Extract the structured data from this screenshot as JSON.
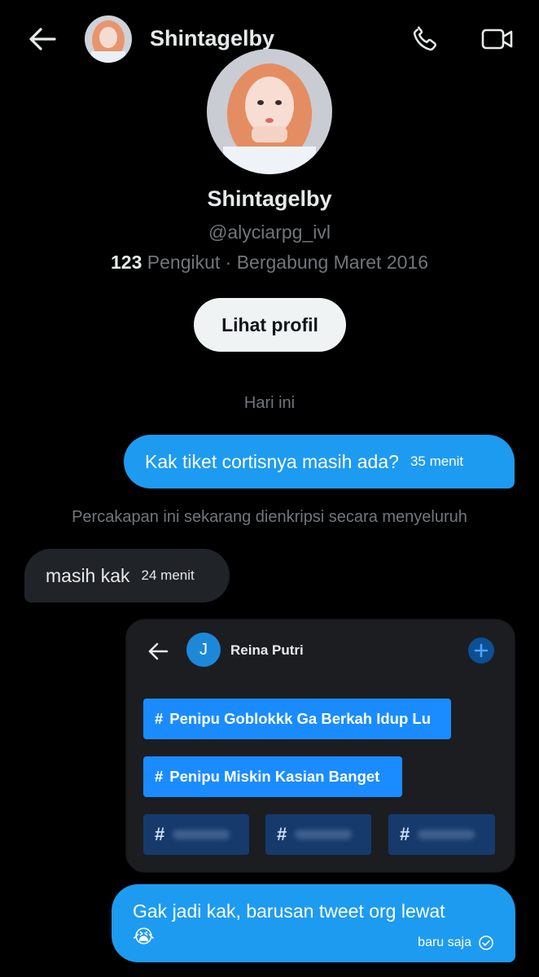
{
  "header": {
    "title": "Shintagelby"
  },
  "profile": {
    "name": "Shintagelby",
    "handle": "@alyciarpg_ivl",
    "followers_count": "123",
    "meta_text": " Pengikut · Bergabung Maret 2016",
    "view_profile_label": "Lihat profil"
  },
  "conversation": {
    "date_label": "Hari ini",
    "encryption_note": "Percakapan ini sekarang dienkripsi secara menyeluruh",
    "messages": [
      {
        "direction": "out",
        "text": "Kak tiket cortisnya masih ada?",
        "time": "35 menit"
      },
      {
        "direction": "in",
        "text": "masih kak",
        "time": "24 menit"
      },
      {
        "direction": "out",
        "text": "Gak jadi kak, barusan tweet org lewat",
        "emoji": "😭",
        "time": "baru saja"
      }
    ]
  },
  "shared_image": {
    "avatar_letter": "J",
    "name": "Reina Putri",
    "tags": [
      {
        "hash": "#",
        "label": "Penipu Goblokkk Ga Berkah Idup Lu"
      },
      {
        "hash": "#",
        "label": "Penipu Miskin Kasian Banget"
      }
    ],
    "blurred_tags": [
      {
        "hash": "#"
      },
      {
        "hash": "#"
      },
      {
        "hash": "#"
      }
    ]
  },
  "colors": {
    "accent": "#1d9bf0",
    "background": "#000000",
    "incoming_bubble": "#202327",
    "muted_text": "#71767b",
    "tag_blue": "#1a8cff"
  },
  "icons": [
    "back-arrow-icon",
    "phone-icon",
    "video-icon",
    "plus-icon",
    "read-check-icon"
  ]
}
